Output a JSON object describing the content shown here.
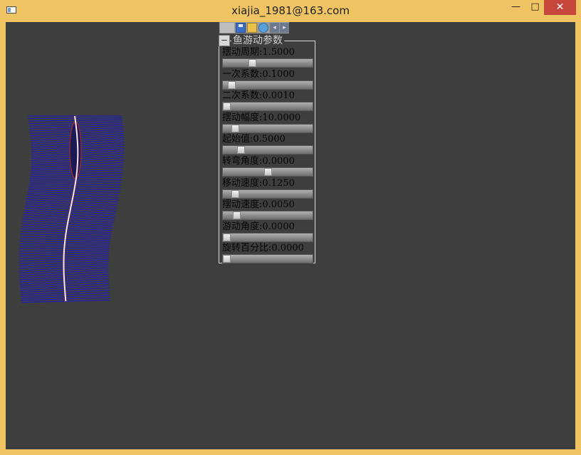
{
  "window": {
    "title": "xiajia_1981@163.com",
    "minimize_glyph": "—",
    "maximize_glyph": "□",
    "close_glyph": "✕"
  },
  "toolbar": {
    "buttons": [
      "blank-icon",
      "save-icon",
      "open-icon",
      "refresh-icon",
      "arrow-left-icon",
      "arrow-right-icon"
    ],
    "prev_glyph": "◂",
    "next_glyph": "▸"
  },
  "panel": {
    "collapse_glyph": "–",
    "title": "鱼游动参数",
    "params": [
      {
        "label": "摆动周期:1.5000",
        "level": 0.31
      },
      {
        "label": "一次系数:0.1000",
        "level": 0.06
      },
      {
        "label": "二次系数:0.0010",
        "level": 0.0
      },
      {
        "label": "摆动幅度:10.0000",
        "level": 0.1
      },
      {
        "label": "起始值:0.5000",
        "level": 0.17
      },
      {
        "label": "转弯角度:0.0000",
        "level": 0.5
      },
      {
        "label": "移动速度:0.1250",
        "level": 0.1
      },
      {
        "label": "摆动速度:0.0050",
        "level": 0.12
      },
      {
        "label": "游动角度:0.0000",
        "level": 0.0
      },
      {
        "label": "旋转百分比:0.0000",
        "level": 0.0
      }
    ]
  },
  "colors": {
    "frame": "#f0c463",
    "viewport": "#3e3e3e",
    "grid": "#1d17d6",
    "spine": "#ffe0f0"
  }
}
